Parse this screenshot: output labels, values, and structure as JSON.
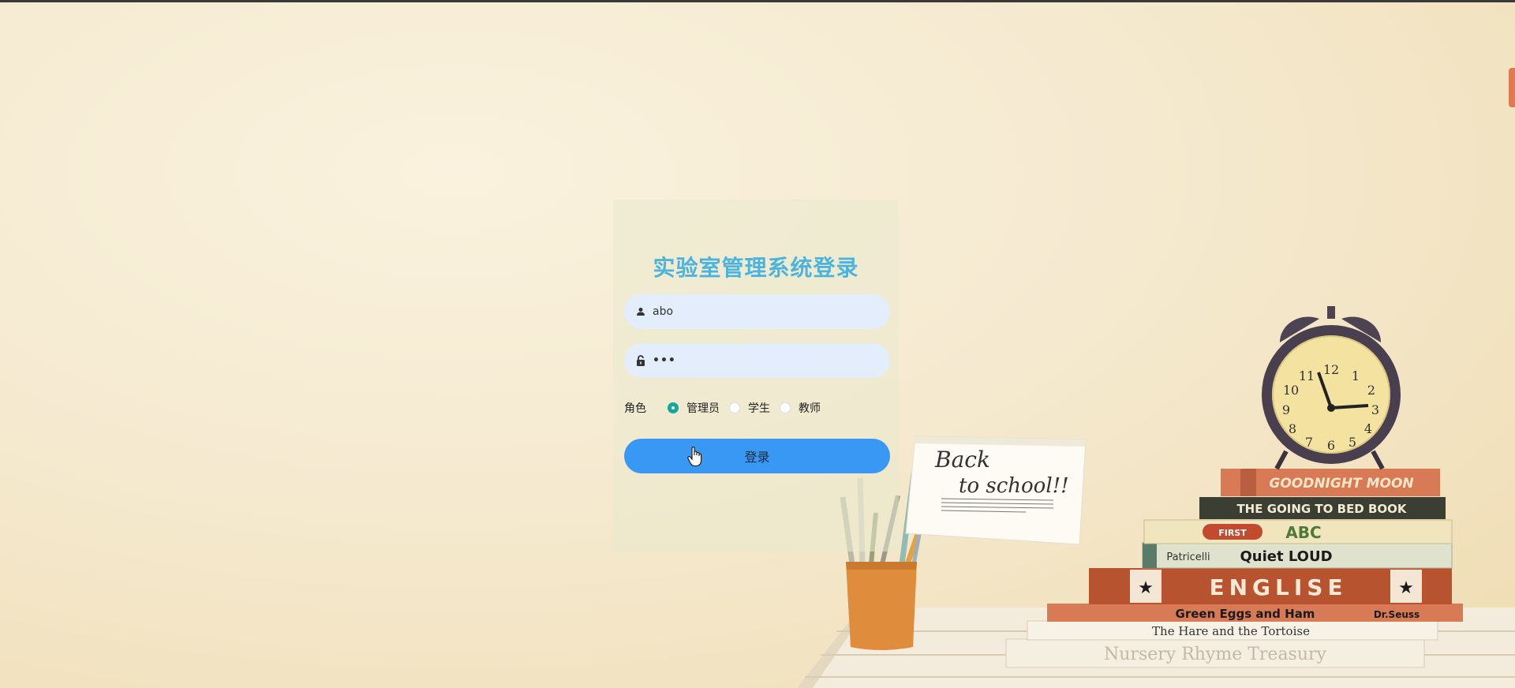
{
  "login": {
    "title": "实验室管理系统登录",
    "username_value": "abo",
    "password_value": "abc",
    "role_label": "角色",
    "roles": [
      {
        "label": "管理员",
        "checked": true
      },
      {
        "label": "学生",
        "checked": false
      },
      {
        "label": "教师",
        "checked": false
      }
    ],
    "submit_label": "登录"
  },
  "illustration": {
    "note_line1": "Back",
    "note_line2": "to school!!",
    "books": [
      "GOODNIGHT MOON",
      "THE GOING TO BED BOOK",
      "ABC",
      "Quiet LOUD",
      "ENGLISE",
      "Green Eggs and Ham",
      "The Hare and the Tortoise",
      "Nursery Rhyme Treasury"
    ],
    "book_small": {
      "first": "FIRST",
      "patricelli": "Patricelli",
      "dr_seuss": "Dr.Seuss"
    },
    "clock_numbers": [
      "12",
      "1",
      "2",
      "3",
      "4",
      "5",
      "6",
      "7",
      "8",
      "9",
      "10",
      "11"
    ]
  },
  "colors": {
    "title": "#4cb4dc",
    "button": "#3a98f5",
    "field_bg": "#e3edfb",
    "radio_checked": "#13a89e"
  }
}
